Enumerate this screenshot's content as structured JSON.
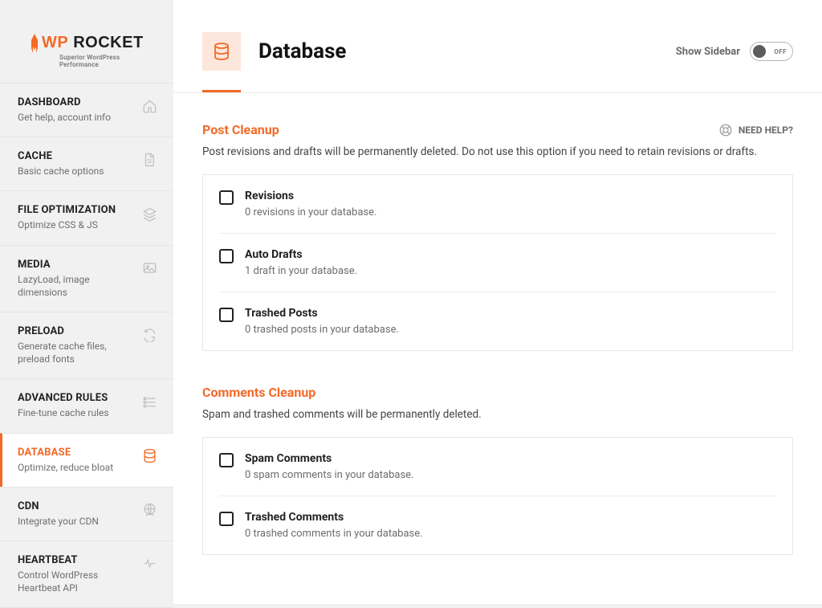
{
  "brand": {
    "name_part1": "WP",
    "name_part2": "ROCKET",
    "tagline": "Superior WordPress Performance"
  },
  "nav": [
    {
      "title": "DASHBOARD",
      "desc": "Get help, account info",
      "icon": "home"
    },
    {
      "title": "CACHE",
      "desc": "Basic cache options",
      "icon": "file"
    },
    {
      "title": "FILE OPTIMIZATION",
      "desc": "Optimize CSS & JS",
      "icon": "layers"
    },
    {
      "title": "MEDIA",
      "desc": "LazyLoad, image dimensions",
      "icon": "image"
    },
    {
      "title": "PRELOAD",
      "desc": "Generate cache files, preload fonts",
      "icon": "refresh"
    },
    {
      "title": "ADVANCED RULES",
      "desc": "Fine-tune cache rules",
      "icon": "sliders"
    },
    {
      "title": "DATABASE",
      "desc": "Optimize, reduce bloat",
      "icon": "database"
    },
    {
      "title": "CDN",
      "desc": "Integrate your CDN",
      "icon": "globe"
    },
    {
      "title": "HEARTBEAT",
      "desc": "Control WordPress Heartbeat API",
      "icon": "heartbeat"
    }
  ],
  "page": {
    "title": "Database",
    "show_sidebar_label": "Show Sidebar",
    "toggle_label": "OFF",
    "need_help": "NEED HELP?"
  },
  "sections": {
    "post_cleanup": {
      "title": "Post Cleanup",
      "desc": "Post revisions and drafts will be permanently deleted. Do not use this option if you need to retain revisions or drafts.",
      "options": [
        {
          "title": "Revisions",
          "desc": "0 revisions in your database."
        },
        {
          "title": "Auto Drafts",
          "desc": "1 draft in your database."
        },
        {
          "title": "Trashed Posts",
          "desc": "0 trashed posts in your database."
        }
      ]
    },
    "comments_cleanup": {
      "title": "Comments Cleanup",
      "desc": "Spam and trashed comments will be permanently deleted.",
      "options": [
        {
          "title": "Spam Comments",
          "desc": "0 spam comments in your database."
        },
        {
          "title": "Trashed Comments",
          "desc": "0 trashed comments in your database."
        }
      ]
    }
  }
}
